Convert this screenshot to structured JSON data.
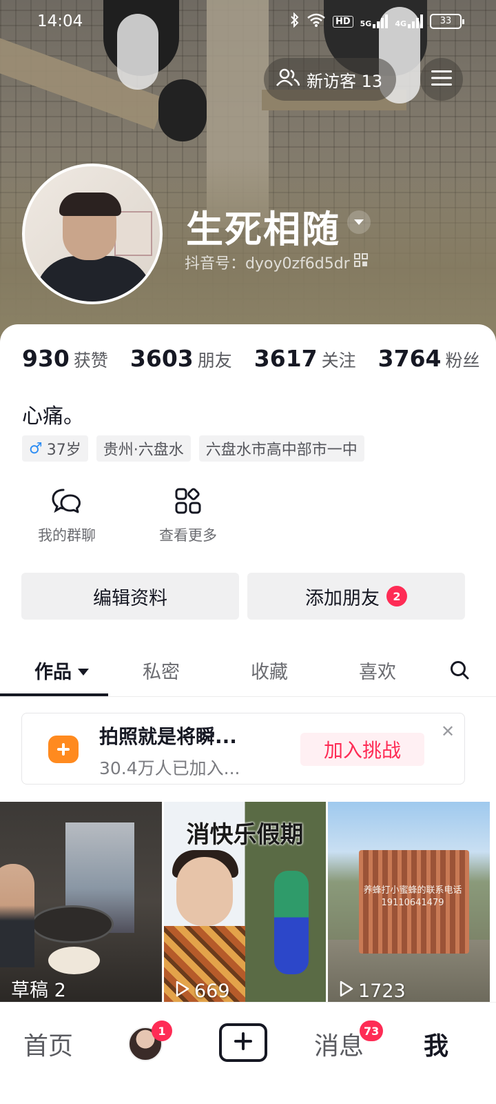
{
  "status_bar": {
    "time": "14:04",
    "network_hd": "HD",
    "network_5g": "5G",
    "network_4g": "4G",
    "battery": "33"
  },
  "header": {
    "visitors_label": "新访客 13",
    "username": "生死相随",
    "douyin_id": "抖音号：dyoy0zf6d5dr"
  },
  "stats": [
    {
      "num": "930",
      "label": "获赞"
    },
    {
      "num": "3603",
      "label": "朋友"
    },
    {
      "num": "3617",
      "label": "关注"
    },
    {
      "num": "3764",
      "label": "粉丝"
    }
  ],
  "profile": {
    "bio": "心痛。",
    "tags": {
      "age": "37岁",
      "location": "贵州·六盘水",
      "school": "六盘水市高中部市一中"
    }
  },
  "shortcuts": {
    "group_chat": "我的群聊",
    "more": "查看更多"
  },
  "actions": {
    "edit_profile": "编辑资料",
    "add_friends": "添加朋友",
    "add_friends_badge": "2"
  },
  "tabs": {
    "works": "作品",
    "private": "私密",
    "favorites": "收藏",
    "likes": "喜欢"
  },
  "challenge": {
    "title": "拍照就是将瞬...",
    "subtitle": "30.4万人已加入...",
    "join_label": "加入挑战"
  },
  "grid": {
    "draft": "草稿 2",
    "video2_banner": "消快乐假期",
    "video2_plays": "669",
    "video3_sign": "养蜂打小蜜蜂的联系电话 19110641479",
    "video3_plays": "1723"
  },
  "bottom_nav": {
    "home": "首页",
    "friends_badge": "1",
    "messages": "消息",
    "messages_badge": "73",
    "me": "我"
  },
  "colors": {
    "accent": "#fe2c55",
    "challenge_icon": "#ff8a1f",
    "male": "#2f8ef3"
  }
}
